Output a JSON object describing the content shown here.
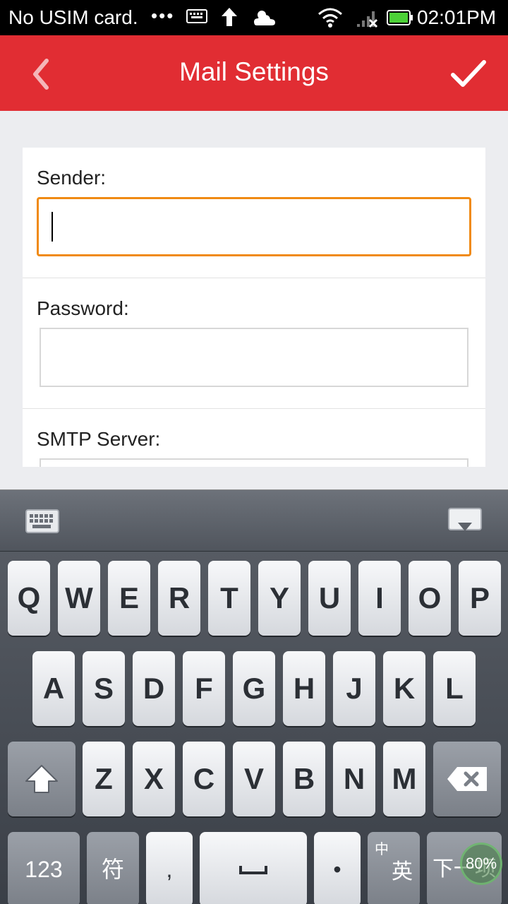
{
  "status_bar": {
    "carrier": "No USIM card.",
    "dots": "•••",
    "time": "02:01PM"
  },
  "app_bar": {
    "title": "Mail Settings",
    "back_icon": "chevron-left-icon",
    "confirm_icon": "checkmark-icon"
  },
  "form": {
    "sender": {
      "label": "Sender:",
      "value": ""
    },
    "password": {
      "label": "Password:",
      "value": ""
    },
    "smtp": {
      "label": "SMTP Server:",
      "value": ""
    }
  },
  "keyboard": {
    "row1": [
      "Q",
      "W",
      "E",
      "R",
      "T",
      "Y",
      "U",
      "I",
      "O",
      "P"
    ],
    "row2": [
      "A",
      "S",
      "D",
      "F",
      "G",
      "H",
      "J",
      "K",
      "L"
    ],
    "row3": [
      "Z",
      "X",
      "C",
      "V",
      "B",
      "N",
      "M"
    ],
    "bottom": {
      "numbers": "123",
      "symbols": "符",
      "comma": ",",
      "period": "•",
      "lang_top": "中",
      "lang_bottom": "英",
      "next": "下一项"
    },
    "zoom_badge": "80%"
  },
  "colors": {
    "accent": "#e12d33",
    "focus": "#f08a13"
  }
}
